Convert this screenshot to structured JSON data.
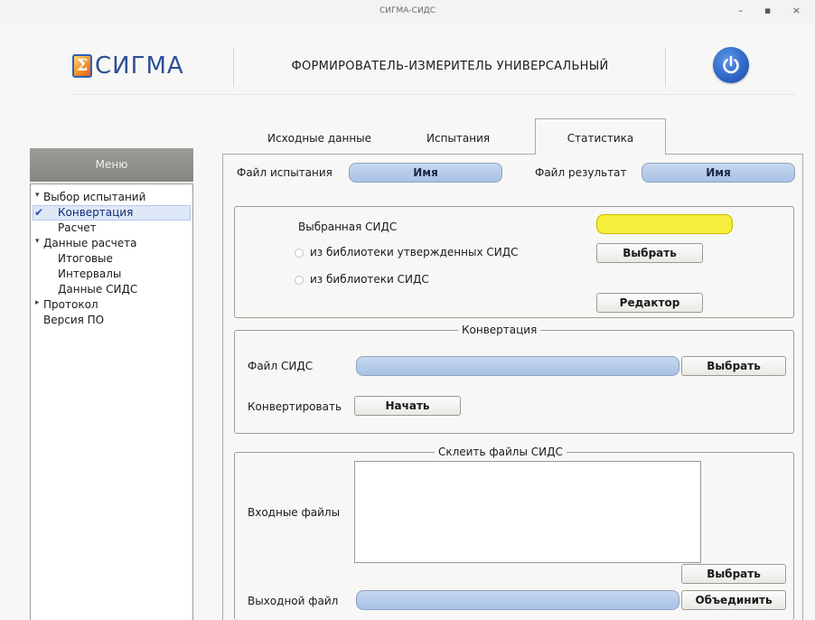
{
  "window": {
    "title": "СИГМА-СИДС",
    "controls": [
      "–",
      "▪",
      "×"
    ]
  },
  "header": {
    "logo_glyph": "Σ",
    "logo_text": "СИГМА",
    "app_title": "ФОРМИРОВАТЕЛЬ-ИЗМЕРИТЕЛЬ УНИВЕРСАЛЬНЫЙ",
    "power_icon": "power-icon",
    "accent": "#2c64c4"
  },
  "sidebar": {
    "header": "Меню",
    "items": [
      {
        "label": "Выбор испытаний",
        "arrow": "▾"
      },
      {
        "label": "Конвертация",
        "selected": true
      },
      {
        "label": "Расчет"
      },
      {
        "label": "Данные расчета",
        "arrow": "▾"
      },
      {
        "label": "Итоговые"
      },
      {
        "label": "Интервалы"
      },
      {
        "label": "Данные СИДС"
      },
      {
        "label": "Протокол",
        "arrow": "▸"
      },
      {
        "label": "Версия ПО"
      }
    ]
  },
  "tabs": [
    {
      "label": "Исходные данные"
    },
    {
      "label": "Испытания"
    },
    {
      "label": "Статистика",
      "active": true
    }
  ],
  "files": {
    "test_label": "Файл испытания",
    "test_value": "Имя",
    "result_label": "Файл результат",
    "result_value": "Имя"
  },
  "sids_select": {
    "label": "Выбранная СИДС",
    "option_approved": "из библиотеки утвержденных СИДС",
    "option_library": "из библиотеки СИДС",
    "select_button": "Выбрать",
    "editor_button": "Редактор",
    "highlight_color": "#f6ee3c"
  },
  "conversion": {
    "title": "Конвертация",
    "file_label": "Файл СИДС",
    "select_button": "Выбрать",
    "convert_label": "Конвертировать",
    "start_button": "Начать"
  },
  "merge": {
    "title": "Склеить файлы СИДС",
    "input_label": "Входные файлы",
    "select_button": "Выбрать",
    "output_label": "Выходной файл",
    "merge_button": "Объединить"
  }
}
